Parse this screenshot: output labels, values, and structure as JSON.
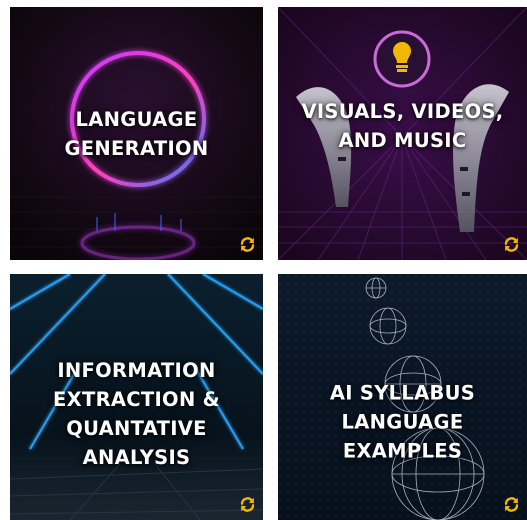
{
  "cards": [
    {
      "title_lines": [
        "LANGUAGE",
        "GENERATION"
      ],
      "flip_icon": "refresh-icon"
    },
    {
      "title_lines": [
        "VISUALS, VIDEOS,",
        "AND MUSIC"
      ],
      "flip_icon": "refresh-icon"
    },
    {
      "title_lines": [
        "INFORMATION",
        "EXTRACTION &",
        "QUANTATIVE",
        "ANALYSIS"
      ],
      "flip_icon": "refresh-icon"
    },
    {
      "title_lines": [
        "AI SYLLABUS",
        "LANGUAGE",
        "EXAMPLES"
      ],
      "flip_icon": "refresh-icon"
    }
  ],
  "colors": {
    "accent_icon": "#f2b705",
    "title_text": "#ffffff"
  }
}
